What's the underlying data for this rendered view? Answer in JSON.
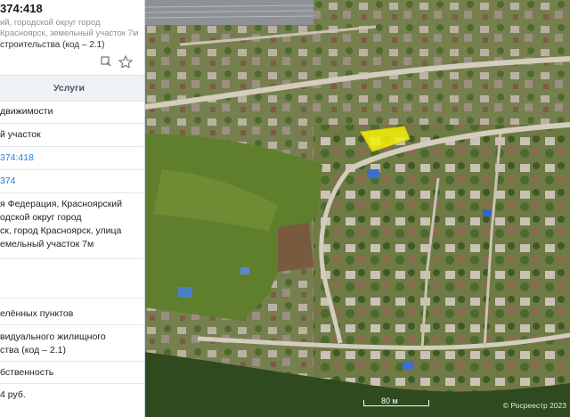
{
  "panel": {
    "title": "374:418",
    "address": "ий, городской округ город Красноярск, земельный участок 7м",
    "purpose": "строительства (код – 2.1)",
    "section_tab": "Услуги",
    "rows": [
      "движимости",
      "й участок",
      "374:418",
      "374",
      "я Федерация, Красноярский",
      "одской округ город",
      "ск, город Красноярск, улица",
      "емельный участок 7м",
      "елённых пунктов",
      "видуального жилищного",
      "ства (код – 2.1)",
      "бственность",
      "4 руб."
    ]
  },
  "icons": [
    "map-marker-icon",
    "star-icon"
  ],
  "map": {
    "scale_label": "80 м",
    "attribution": "© Росреестр 2023",
    "highlight_color": "#f5f20a"
  }
}
